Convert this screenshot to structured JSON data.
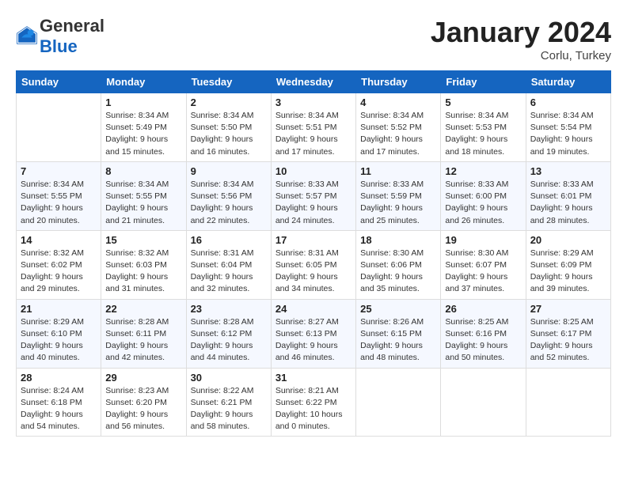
{
  "header": {
    "logo_general": "General",
    "logo_blue": "Blue",
    "month": "January 2024",
    "location": "Corlu, Turkey"
  },
  "columns": [
    "Sunday",
    "Monday",
    "Tuesday",
    "Wednesday",
    "Thursday",
    "Friday",
    "Saturday"
  ],
  "weeks": [
    [
      {
        "day": "",
        "info": ""
      },
      {
        "day": "1",
        "info": "Sunrise: 8:34 AM\nSunset: 5:49 PM\nDaylight: 9 hours\nand 15 minutes."
      },
      {
        "day": "2",
        "info": "Sunrise: 8:34 AM\nSunset: 5:50 PM\nDaylight: 9 hours\nand 16 minutes."
      },
      {
        "day": "3",
        "info": "Sunrise: 8:34 AM\nSunset: 5:51 PM\nDaylight: 9 hours\nand 17 minutes."
      },
      {
        "day": "4",
        "info": "Sunrise: 8:34 AM\nSunset: 5:52 PM\nDaylight: 9 hours\nand 17 minutes."
      },
      {
        "day": "5",
        "info": "Sunrise: 8:34 AM\nSunset: 5:53 PM\nDaylight: 9 hours\nand 18 minutes."
      },
      {
        "day": "6",
        "info": "Sunrise: 8:34 AM\nSunset: 5:54 PM\nDaylight: 9 hours\nand 19 minutes."
      }
    ],
    [
      {
        "day": "7",
        "info": "Sunrise: 8:34 AM\nSunset: 5:55 PM\nDaylight: 9 hours\nand 20 minutes."
      },
      {
        "day": "8",
        "info": "Sunrise: 8:34 AM\nSunset: 5:55 PM\nDaylight: 9 hours\nand 21 minutes."
      },
      {
        "day": "9",
        "info": "Sunrise: 8:34 AM\nSunset: 5:56 PM\nDaylight: 9 hours\nand 22 minutes."
      },
      {
        "day": "10",
        "info": "Sunrise: 8:33 AM\nSunset: 5:57 PM\nDaylight: 9 hours\nand 24 minutes."
      },
      {
        "day": "11",
        "info": "Sunrise: 8:33 AM\nSunset: 5:59 PM\nDaylight: 9 hours\nand 25 minutes."
      },
      {
        "day": "12",
        "info": "Sunrise: 8:33 AM\nSunset: 6:00 PM\nDaylight: 9 hours\nand 26 minutes."
      },
      {
        "day": "13",
        "info": "Sunrise: 8:33 AM\nSunset: 6:01 PM\nDaylight: 9 hours\nand 28 minutes."
      }
    ],
    [
      {
        "day": "14",
        "info": "Sunrise: 8:32 AM\nSunset: 6:02 PM\nDaylight: 9 hours\nand 29 minutes."
      },
      {
        "day": "15",
        "info": "Sunrise: 8:32 AM\nSunset: 6:03 PM\nDaylight: 9 hours\nand 31 minutes."
      },
      {
        "day": "16",
        "info": "Sunrise: 8:31 AM\nSunset: 6:04 PM\nDaylight: 9 hours\nand 32 minutes."
      },
      {
        "day": "17",
        "info": "Sunrise: 8:31 AM\nSunset: 6:05 PM\nDaylight: 9 hours\nand 34 minutes."
      },
      {
        "day": "18",
        "info": "Sunrise: 8:30 AM\nSunset: 6:06 PM\nDaylight: 9 hours\nand 35 minutes."
      },
      {
        "day": "19",
        "info": "Sunrise: 8:30 AM\nSunset: 6:07 PM\nDaylight: 9 hours\nand 37 minutes."
      },
      {
        "day": "20",
        "info": "Sunrise: 8:29 AM\nSunset: 6:09 PM\nDaylight: 9 hours\nand 39 minutes."
      }
    ],
    [
      {
        "day": "21",
        "info": "Sunrise: 8:29 AM\nSunset: 6:10 PM\nDaylight: 9 hours\nand 40 minutes."
      },
      {
        "day": "22",
        "info": "Sunrise: 8:28 AM\nSunset: 6:11 PM\nDaylight: 9 hours\nand 42 minutes."
      },
      {
        "day": "23",
        "info": "Sunrise: 8:28 AM\nSunset: 6:12 PM\nDaylight: 9 hours\nand 44 minutes."
      },
      {
        "day": "24",
        "info": "Sunrise: 8:27 AM\nSunset: 6:13 PM\nDaylight: 9 hours\nand 46 minutes."
      },
      {
        "day": "25",
        "info": "Sunrise: 8:26 AM\nSunset: 6:15 PM\nDaylight: 9 hours\nand 48 minutes."
      },
      {
        "day": "26",
        "info": "Sunrise: 8:25 AM\nSunset: 6:16 PM\nDaylight: 9 hours\nand 50 minutes."
      },
      {
        "day": "27",
        "info": "Sunrise: 8:25 AM\nSunset: 6:17 PM\nDaylight: 9 hours\nand 52 minutes."
      }
    ],
    [
      {
        "day": "28",
        "info": "Sunrise: 8:24 AM\nSunset: 6:18 PM\nDaylight: 9 hours\nand 54 minutes."
      },
      {
        "day": "29",
        "info": "Sunrise: 8:23 AM\nSunset: 6:20 PM\nDaylight: 9 hours\nand 56 minutes."
      },
      {
        "day": "30",
        "info": "Sunrise: 8:22 AM\nSunset: 6:21 PM\nDaylight: 9 hours\nand 58 minutes."
      },
      {
        "day": "31",
        "info": "Sunrise: 8:21 AM\nSunset: 6:22 PM\nDaylight: 10 hours\nand 0 minutes."
      },
      {
        "day": "",
        "info": ""
      },
      {
        "day": "",
        "info": ""
      },
      {
        "day": "",
        "info": ""
      }
    ]
  ]
}
